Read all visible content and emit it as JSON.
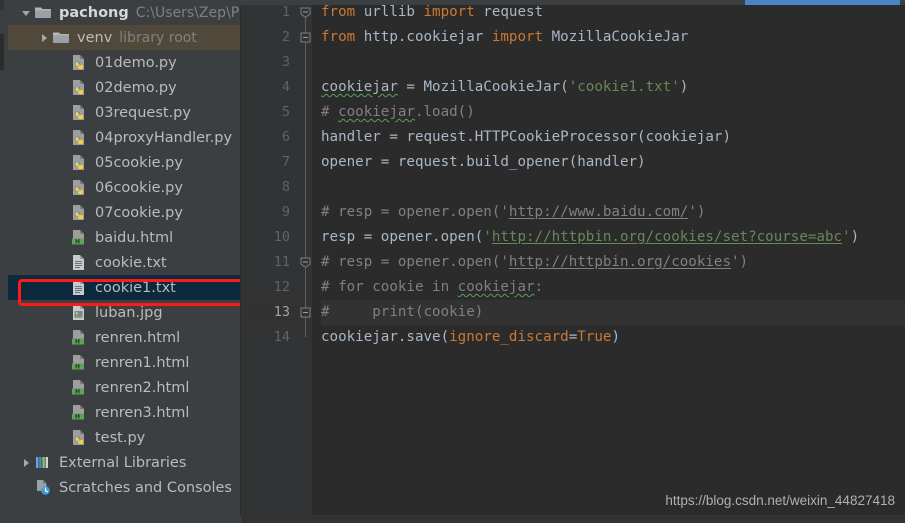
{
  "window": {
    "theme_bg": "#2b2b2b",
    "panel_bg": "#3c3f41",
    "accent_blue": "#4a86c5",
    "selection_bg": "#0d293e",
    "annotation_color": "#ff1a1a"
  },
  "project_tree": {
    "items": [
      {
        "label": "pachong",
        "secondary": "C:\\Users\\Zep\\P",
        "icon": "folder-icon",
        "depth": 0,
        "twisty": "down",
        "bold": true,
        "state": "normal"
      },
      {
        "label": "venv",
        "secondary": "library root",
        "icon": "folder-icon",
        "depth": 1,
        "twisty": "right",
        "bold": false,
        "state": "hover"
      },
      {
        "label": "01demo.py",
        "secondary": "",
        "icon": "python-file-icon",
        "depth": 2,
        "twisty": "none",
        "bold": false,
        "state": "normal"
      },
      {
        "label": "02demo.py",
        "secondary": "",
        "icon": "python-file-icon",
        "depth": 2,
        "twisty": "none",
        "bold": false,
        "state": "normal"
      },
      {
        "label": "03request.py",
        "secondary": "",
        "icon": "python-file-icon",
        "depth": 2,
        "twisty": "none",
        "bold": false,
        "state": "normal"
      },
      {
        "label": "04proxyHandler.py",
        "secondary": "",
        "icon": "python-file-icon",
        "depth": 2,
        "twisty": "none",
        "bold": false,
        "state": "normal"
      },
      {
        "label": "05cookie.py",
        "secondary": "",
        "icon": "python-file-icon",
        "depth": 2,
        "twisty": "none",
        "bold": false,
        "state": "normal"
      },
      {
        "label": "06cookie.py",
        "secondary": "",
        "icon": "python-file-icon",
        "depth": 2,
        "twisty": "none",
        "bold": false,
        "state": "normal"
      },
      {
        "label": "07cookie.py",
        "secondary": "",
        "icon": "python-file-icon",
        "depth": 2,
        "twisty": "none",
        "bold": false,
        "state": "normal"
      },
      {
        "label": "baidu.html",
        "secondary": "",
        "icon": "html-file-icon",
        "depth": 2,
        "twisty": "none",
        "bold": false,
        "state": "normal"
      },
      {
        "label": "cookie.txt",
        "secondary": "",
        "icon": "text-file-icon",
        "depth": 2,
        "twisty": "none",
        "bold": false,
        "state": "normal"
      },
      {
        "label": "cookie1.txt",
        "secondary": "",
        "icon": "text-file-icon",
        "depth": 2,
        "twisty": "none",
        "bold": false,
        "state": "selected"
      },
      {
        "label": "luban.jpg",
        "secondary": "",
        "icon": "image-file-icon",
        "depth": 2,
        "twisty": "none",
        "bold": false,
        "state": "normal"
      },
      {
        "label": "renren.html",
        "secondary": "",
        "icon": "html-file-icon",
        "depth": 2,
        "twisty": "none",
        "bold": false,
        "state": "normal"
      },
      {
        "label": "renren1.html",
        "secondary": "",
        "icon": "html-file-icon",
        "depth": 2,
        "twisty": "none",
        "bold": false,
        "state": "normal"
      },
      {
        "label": "renren2.html",
        "secondary": "",
        "icon": "html-file-icon",
        "depth": 2,
        "twisty": "none",
        "bold": false,
        "state": "normal"
      },
      {
        "label": "renren3.html",
        "secondary": "",
        "icon": "html-file-icon",
        "depth": 2,
        "twisty": "none",
        "bold": false,
        "state": "normal"
      },
      {
        "label": "test.py",
        "secondary": "",
        "icon": "python-file-icon",
        "depth": 2,
        "twisty": "none",
        "bold": false,
        "state": "normal"
      },
      {
        "label": "External Libraries",
        "secondary": "",
        "icon": "libraries-icon",
        "depth": 0,
        "twisty": "right",
        "bold": false,
        "state": "normal"
      },
      {
        "label": "Scratches and Consoles",
        "secondary": "",
        "icon": "scratches-icon",
        "depth": 0,
        "twisty": "none",
        "bold": false,
        "state": "normal"
      }
    ]
  },
  "editor": {
    "line_numbers": [
      "1",
      "2",
      "3",
      "4",
      "5",
      "6",
      "7",
      "8",
      "9",
      "10",
      "11",
      "12",
      "13",
      "14"
    ],
    "current_line": 13,
    "lines": [
      {
        "n": 1,
        "fold": "collapse-top",
        "text": "from urllib import request"
      },
      {
        "n": 2,
        "fold": "collapse-end",
        "text": "from http.cookiejar import MozillaCookieJar"
      },
      {
        "n": 3,
        "fold": "none",
        "text": ""
      },
      {
        "n": 4,
        "fold": "none",
        "text": "cookiejar = MozillaCookieJar('cookie1.txt')"
      },
      {
        "n": 5,
        "fold": "none",
        "text": "# cookiejar.load()"
      },
      {
        "n": 6,
        "fold": "none",
        "text": "handler = request.HTTPCookieProcessor(cookiejar)"
      },
      {
        "n": 7,
        "fold": "none",
        "text": "opener = request.build_opener(handler)"
      },
      {
        "n": 8,
        "fold": "none",
        "text": ""
      },
      {
        "n": 9,
        "fold": "none",
        "text": "# resp = opener.open('http://www.baidu.com/')"
      },
      {
        "n": 10,
        "fold": "none",
        "text": "resp = opener.open('http://httpbin.org/cookies/set?course=abc')"
      },
      {
        "n": 11,
        "fold": "collapse-top",
        "text": "# resp = opener.open('http://httpbin.org/cookies')"
      },
      {
        "n": 12,
        "fold": "none",
        "text": "# for cookie in cookiejar:"
      },
      {
        "n": 13,
        "fold": "collapse-end",
        "text": "#     print(cookie)"
      },
      {
        "n": 14,
        "fold": "none",
        "text": "cookiejar.save(ignore_discard=True)"
      }
    ],
    "tokens": {
      "kw_from": "from",
      "kw_import": "import",
      "mod_urllib": "urllib",
      "mod_request": "request",
      "mod_http_cookiejar": "http.cookiejar",
      "cls_mozillacookiejar": "MozillaCookieJar",
      "var_cookiejar": "cookiejar",
      "str_cookie1": "'cookie1.txt'",
      "var_handler": "handler",
      "attr_httpcookieprocessor": ".HTTPCookieProcessor",
      "var_opener": "opener",
      "attr_build_opener": ".build_opener",
      "var_resp": "resp",
      "attr_open": ".open",
      "url_baidu": "http://www.baidu.com/",
      "url_httpbin_set": "http://httpbin.org/cookies/set?course=abc",
      "url_httpbin": "http://httpbin.org/cookies",
      "attr_save": ".save",
      "param_ignore_discard": "ignore_discard",
      "kw_true": "True"
    }
  },
  "watermark": {
    "text": "https://blog.csdn.net/weixin_44827418"
  }
}
